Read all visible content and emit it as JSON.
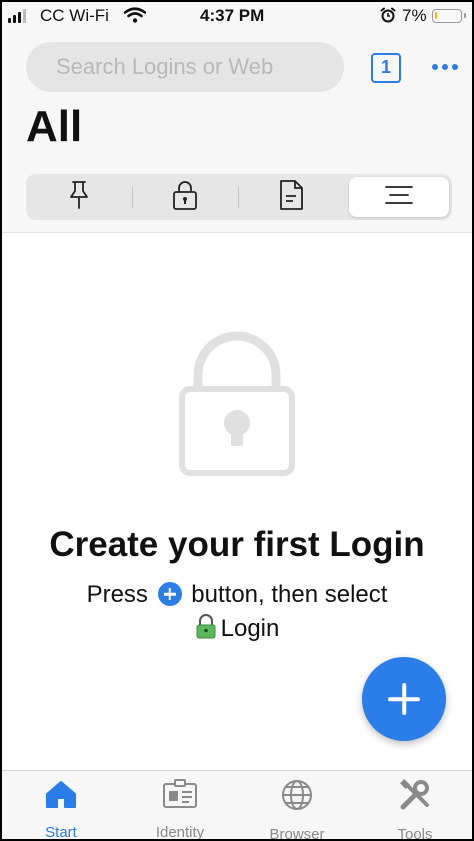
{
  "status_bar": {
    "carrier": "CC Wi-Fi",
    "time": "4:37 PM",
    "battery": "7%",
    "battery_level": 0.07
  },
  "header": {
    "search_placeholder": "Search Logins or Web",
    "tab_count": "1",
    "more_icon": "ellipsis-icon"
  },
  "page_title": "All",
  "filter_segments": [
    {
      "icon": "pin-icon",
      "active": false
    },
    {
      "icon": "lock-icon",
      "active": false
    },
    {
      "icon": "note-icon",
      "active": false
    },
    {
      "icon": "list-icon",
      "active": true
    }
  ],
  "empty_state": {
    "icon": "lock-icon",
    "title": "Create your first Login",
    "hint_prefix": "Press",
    "hint_suffix": "button, then select",
    "hint_item": "Login"
  },
  "fab": {
    "icon": "plus-icon"
  },
  "tabbar": [
    {
      "label": "Start",
      "icon": "home-icon",
      "active": true
    },
    {
      "label": "Identity",
      "icon": "id-card-icon",
      "active": false
    },
    {
      "label": "Browser",
      "icon": "globe-icon",
      "active": false
    },
    {
      "label": "Tools",
      "icon": "tools-icon",
      "active": false
    }
  ],
  "colors": {
    "accent": "#2b7de9",
    "lock_green": "#5cb85c"
  }
}
